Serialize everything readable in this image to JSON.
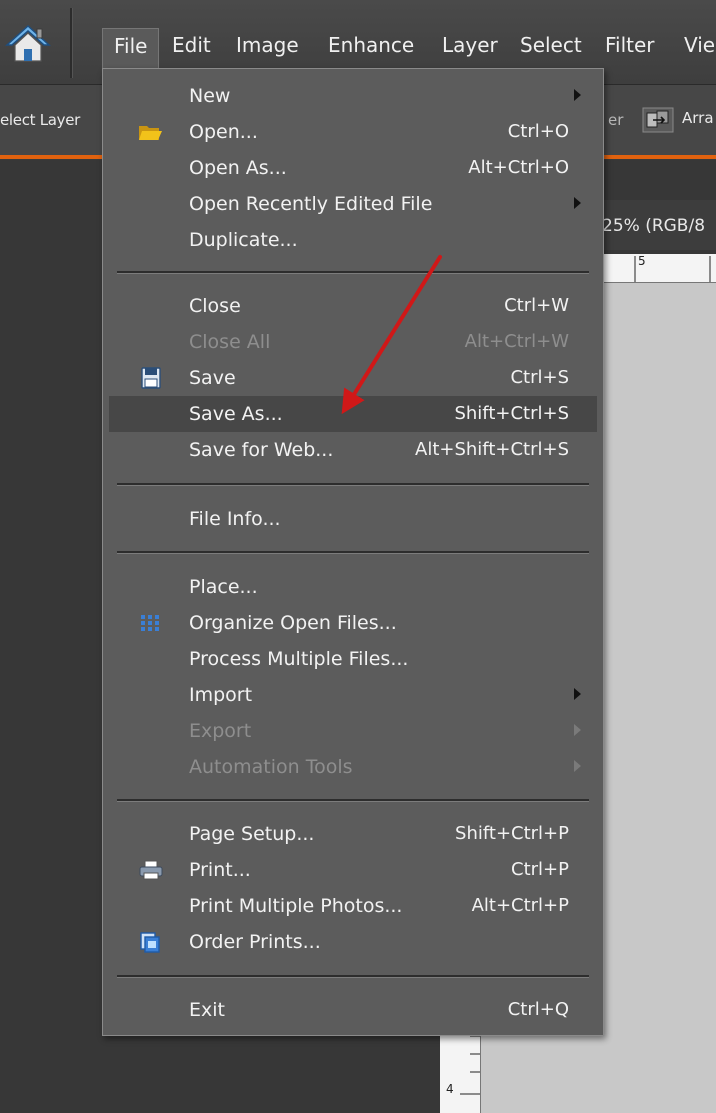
{
  "menubar": {
    "items": [
      {
        "label": "File"
      },
      {
        "label": "Edit"
      },
      {
        "label": "Image"
      },
      {
        "label": "Enhance"
      },
      {
        "label": "Layer"
      },
      {
        "label": "Select"
      },
      {
        "label": "Filter"
      },
      {
        "label": "Vie"
      }
    ]
  },
  "options_bar": {
    "select_layer_label": "elect Layer",
    "partial_label": "er",
    "arrange_label": "Arra"
  },
  "document": {
    "tab_label": "25% (RGB/8",
    "ruler_top_number": "5",
    "ruler_left_number": "4"
  },
  "file_menu": {
    "groups": [
      [
        {
          "label": "New",
          "shortcut": "",
          "submenu": true,
          "disabled": false,
          "icon": ""
        },
        {
          "label": "Open...",
          "shortcut": "Ctrl+O",
          "submenu": false,
          "disabled": false,
          "icon": "folder-icon"
        },
        {
          "label": "Open As...",
          "shortcut": "Alt+Ctrl+O",
          "submenu": false,
          "disabled": false,
          "icon": ""
        },
        {
          "label": "Open Recently Edited File",
          "shortcut": "",
          "submenu": true,
          "disabled": false,
          "icon": ""
        },
        {
          "label": "Duplicate...",
          "shortcut": "",
          "submenu": false,
          "disabled": false,
          "icon": ""
        }
      ],
      [
        {
          "label": "Close",
          "shortcut": "Ctrl+W",
          "submenu": false,
          "disabled": false,
          "icon": ""
        },
        {
          "label": "Close All",
          "shortcut": "Alt+Ctrl+W",
          "submenu": false,
          "disabled": true,
          "icon": ""
        },
        {
          "label": "Save",
          "shortcut": "Ctrl+S",
          "submenu": false,
          "disabled": false,
          "icon": "save-icon"
        },
        {
          "label": "Save As...",
          "shortcut": "Shift+Ctrl+S",
          "submenu": false,
          "disabled": false,
          "icon": "",
          "highlighted": true
        },
        {
          "label": "Save for Web...",
          "shortcut": "Alt+Shift+Ctrl+S",
          "submenu": false,
          "disabled": false,
          "icon": ""
        }
      ],
      [
        {
          "label": "File Info...",
          "shortcut": "",
          "submenu": false,
          "disabled": false,
          "icon": ""
        }
      ],
      [
        {
          "label": "Place...",
          "shortcut": "",
          "submenu": false,
          "disabled": false,
          "icon": ""
        },
        {
          "label": "Organize Open Files...",
          "shortcut": "",
          "submenu": false,
          "disabled": false,
          "icon": "grid-icon"
        },
        {
          "label": "Process Multiple Files...",
          "shortcut": "",
          "submenu": false,
          "disabled": false,
          "icon": ""
        },
        {
          "label": "Import",
          "shortcut": "",
          "submenu": true,
          "disabled": false,
          "icon": ""
        },
        {
          "label": "Export",
          "shortcut": "",
          "submenu": true,
          "disabled": true,
          "icon": ""
        },
        {
          "label": "Automation Tools",
          "shortcut": "",
          "submenu": true,
          "disabled": true,
          "icon": ""
        }
      ],
      [
        {
          "label": "Page Setup...",
          "shortcut": "Shift+Ctrl+P",
          "submenu": false,
          "disabled": false,
          "icon": ""
        },
        {
          "label": "Print...",
          "shortcut": "Ctrl+P",
          "submenu": false,
          "disabled": false,
          "icon": "printer-icon"
        },
        {
          "label": "Print Multiple Photos...",
          "shortcut": "Alt+Ctrl+P",
          "submenu": false,
          "disabled": false,
          "icon": ""
        },
        {
          "label": "Order Prints...",
          "shortcut": "",
          "submenu": false,
          "disabled": false,
          "icon": "order-prints-icon"
        }
      ],
      [
        {
          "label": "Exit",
          "shortcut": "Ctrl+Q",
          "submenu": false,
          "disabled": false,
          "icon": ""
        }
      ]
    ]
  },
  "colors": {
    "menu_background": "#5c5c5c",
    "menu_highlight": "#474747",
    "accent_orange": "#e1620f",
    "annotation_arrow": "#d01818"
  }
}
